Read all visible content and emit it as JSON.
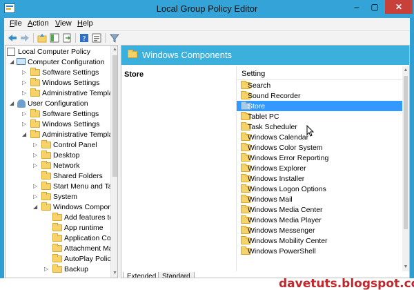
{
  "window": {
    "title": "Local Group Policy Editor",
    "minimize": "–",
    "maximize": "▢",
    "close": "✕"
  },
  "menu": [
    {
      "key": "F",
      "rest": "ile"
    },
    {
      "key": "A",
      "rest": "ction"
    },
    {
      "key": "V",
      "rest": "iew"
    },
    {
      "key": "H",
      "rest": "elp"
    }
  ],
  "toolbar_icons": [
    "back-icon",
    "forward-icon",
    "up-folder-icon",
    "show-hide-tree-icon",
    "export-list-icon",
    "help-icon",
    "properties-icon",
    "filter-icon"
  ],
  "tree": {
    "items": [
      {
        "label": "Local Computer Policy",
        "icon": "policy-icon"
      },
      {
        "label": "Computer Configuration",
        "icon": "computer-icon",
        "arrow": "◢"
      },
      {
        "label": "Software Settings",
        "icon": "folder-icon",
        "arrow": "▷"
      },
      {
        "label": "Windows Settings",
        "icon": "folder-icon",
        "arrow": "▷"
      },
      {
        "label": "Administrative Templat",
        "icon": "folder-icon",
        "arrow": "▷"
      },
      {
        "label": "User Configuration",
        "icon": "user-icon",
        "arrow": "◢"
      },
      {
        "label": "Software Settings",
        "icon": "folder-icon",
        "arrow": "▷"
      },
      {
        "label": "Windows Settings",
        "icon": "folder-icon",
        "arrow": "▷"
      },
      {
        "label": "Administrative Templat",
        "icon": "folder-icon",
        "arrow": "◢"
      },
      {
        "label": "Control Panel",
        "icon": "folder-icon",
        "arrow": "▷"
      },
      {
        "label": "Desktop",
        "icon": "folder-icon",
        "arrow": "▷"
      },
      {
        "label": "Network",
        "icon": "folder-icon",
        "arrow": "▷"
      },
      {
        "label": "Shared Folders",
        "icon": "folder-icon"
      },
      {
        "label": "Start Menu and Task",
        "icon": "folder-icon",
        "arrow": "▷"
      },
      {
        "label": "System",
        "icon": "folder-icon",
        "arrow": "▷"
      },
      {
        "label": "Windows Compone",
        "icon": "folder-icon",
        "arrow": "◢"
      },
      {
        "label": "Add features to W",
        "icon": "folder-icon"
      },
      {
        "label": "App runtime",
        "icon": "folder-icon"
      },
      {
        "label": "Application Com",
        "icon": "folder-icon"
      },
      {
        "label": "Attachment Man",
        "icon": "folder-icon"
      },
      {
        "label": "AutoPlay Policie",
        "icon": "folder-icon"
      },
      {
        "label": "Backup",
        "icon": "folder-icon",
        "arrow": "▷"
      }
    ]
  },
  "right": {
    "header_title": "Windows Components",
    "detail_title": "Store",
    "list_header": "Setting",
    "items": [
      "Search",
      "Sound Recorder",
      "Store",
      "Tablet PC",
      "Task Scheduler",
      "Windows Calendar",
      "Windows Color System",
      "Windows Error Reporting",
      "Windows Explorer",
      "Windows Installer",
      "Windows Logon Options",
      "Windows Mail",
      "Windows Media Center",
      "Windows Media Player",
      "Windows Messenger",
      "Windows Mobility Center",
      "Windows PowerShell"
    ],
    "selected_item": "Store"
  },
  "tabs": {
    "extended": "Extended",
    "standard": "Standard"
  },
  "watermark": "davetuts.blogspot.com",
  "colors": {
    "titlebar": "#33a3d8",
    "header_band": "#3bb0dc",
    "selection": "#3399ff",
    "close_button": "#c7403a",
    "watermark": "#c0282d"
  }
}
